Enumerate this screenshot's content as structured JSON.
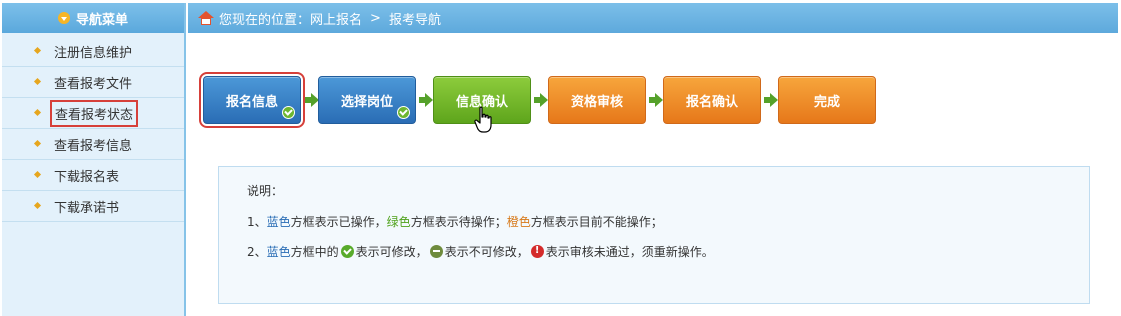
{
  "sidebar": {
    "title": "导航菜单",
    "title_icon": "menu-down-icon",
    "items": [
      {
        "label": "注册信息维护",
        "highlighted": false
      },
      {
        "label": "查看报考文件",
        "highlighted": false
      },
      {
        "label": "查看报考状态",
        "highlighted": true
      },
      {
        "label": "查看报考信息",
        "highlighted": false
      },
      {
        "label": "下载报名表",
        "highlighted": false
      },
      {
        "label": "下载承诺书",
        "highlighted": false
      }
    ]
  },
  "breadcrumb": {
    "icon": "home-icon",
    "prefix": "您现在的位置：",
    "level1": "网上报名",
    "separator": ">",
    "level2": "报考导航"
  },
  "steps": [
    {
      "label": "报名信息",
      "state": "blue",
      "checked": true,
      "selected": true
    },
    {
      "label": "选择岗位",
      "state": "blue",
      "checked": true,
      "selected": false
    },
    {
      "label": "信息确认",
      "state": "green",
      "checked": false,
      "selected": false
    },
    {
      "label": "资格审核",
      "state": "orange",
      "checked": false,
      "selected": false
    },
    {
      "label": "报名确认",
      "state": "orange",
      "checked": false,
      "selected": false
    },
    {
      "label": "完成",
      "state": "orange",
      "checked": false,
      "selected": false
    }
  ],
  "notes": {
    "title": "说明：",
    "line1": {
      "num": "1、",
      "blue": "蓝色",
      "t1": "方框表示已操作，",
      "green": "绿色",
      "t2": "方框表示待操作；",
      "orange": "橙色",
      "t3": "方框表示目前不能操作；"
    },
    "line2": {
      "num": "2、",
      "blue": "蓝色",
      "t1": "方框中的",
      "t2": "表示可修改，",
      "t3": "表示不可修改，",
      "t4": "表示审核未通过，须重新操作。"
    }
  },
  "colors": {
    "header_blue": "#5ea9dc",
    "step_blue": "#2a6db5",
    "step_green": "#5ea51c",
    "step_orange": "#e6781a",
    "highlight_red": "#d6403a"
  }
}
